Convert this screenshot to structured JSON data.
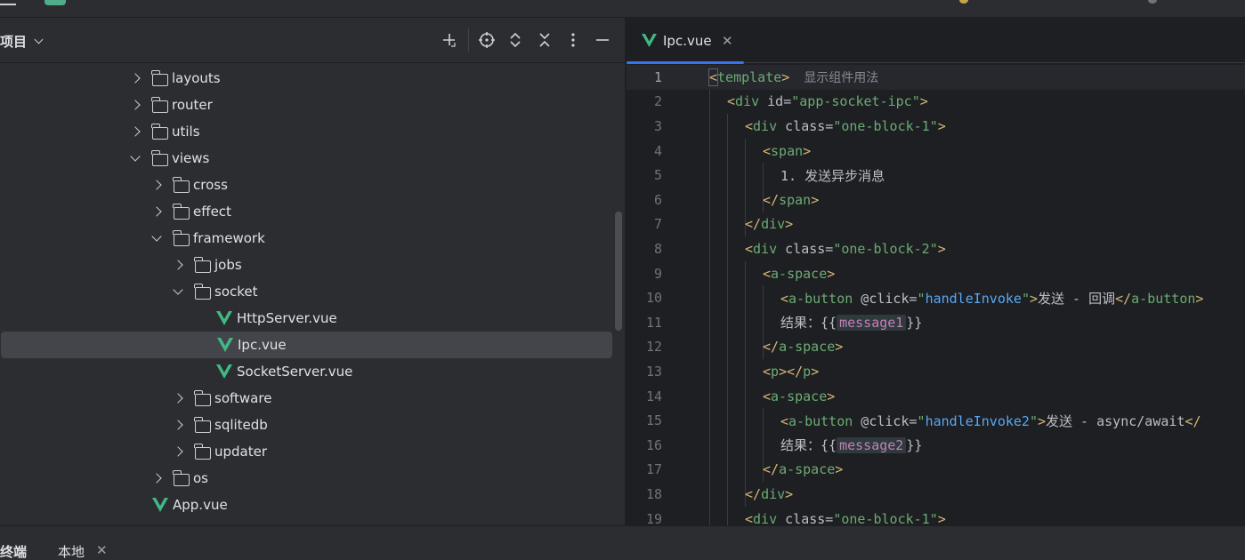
{
  "project_panel": {
    "title": "项目",
    "tree": [
      {
        "label": "layouts",
        "type": "folder",
        "expanded": false,
        "depth": 0
      },
      {
        "label": "router",
        "type": "folder",
        "expanded": false,
        "depth": 0
      },
      {
        "label": "utils",
        "type": "folder",
        "expanded": false,
        "depth": 0
      },
      {
        "label": "views",
        "type": "folder",
        "expanded": true,
        "depth": 0
      },
      {
        "label": "cross",
        "type": "folder",
        "expanded": false,
        "depth": 1
      },
      {
        "label": "effect",
        "type": "folder",
        "expanded": false,
        "depth": 1
      },
      {
        "label": "framework",
        "type": "folder",
        "expanded": true,
        "depth": 1
      },
      {
        "label": "jobs",
        "type": "folder",
        "expanded": false,
        "depth": 2
      },
      {
        "label": "socket",
        "type": "folder",
        "expanded": true,
        "depth": 2
      },
      {
        "label": "HttpServer.vue",
        "type": "vue",
        "depth": 3
      },
      {
        "label": "Ipc.vue",
        "type": "vue",
        "depth": 3,
        "selected": true
      },
      {
        "label": "SocketServer.vue",
        "type": "vue",
        "depth": 3
      },
      {
        "label": "software",
        "type": "folder",
        "expanded": false,
        "depth": 2
      },
      {
        "label": "sqlitedb",
        "type": "folder",
        "expanded": false,
        "depth": 2
      },
      {
        "label": "updater",
        "type": "folder",
        "expanded": false,
        "depth": 2
      },
      {
        "label": "os",
        "type": "folder",
        "expanded": false,
        "depth": 1
      },
      {
        "label": "App.vue",
        "type": "vue",
        "depth": 0
      }
    ]
  },
  "editor": {
    "tab_label": "Ipc.vue",
    "close_glyph": "✕",
    "inlay_hint": "显示组件用法",
    "lines": [
      {
        "n": "1",
        "indent": 0,
        "parts": [
          [
            "bracket-hl",
            "<"
          ],
          [
            "tn",
            "template"
          ],
          [
            "tg",
            ">"
          ]
        ],
        "hint": true
      },
      {
        "n": "2",
        "indent": 1,
        "parts": [
          [
            "tg",
            "<"
          ],
          [
            "tn",
            "div"
          ],
          [
            "an",
            " id="
          ],
          [
            "av",
            "\"app-socket-ipc\""
          ],
          [
            "tg",
            ">"
          ]
        ]
      },
      {
        "n": "3",
        "indent": 2,
        "parts": [
          [
            "tg",
            "<"
          ],
          [
            "tn",
            "div"
          ],
          [
            "an",
            " class="
          ],
          [
            "av",
            "\"one-block-1\""
          ],
          [
            "tg",
            ">"
          ]
        ]
      },
      {
        "n": "4",
        "indent": 3,
        "parts": [
          [
            "tg",
            "<"
          ],
          [
            "tn",
            "span"
          ],
          [
            "tg",
            ">"
          ]
        ]
      },
      {
        "n": "5",
        "indent": 4,
        "parts": [
          [
            "tx",
            "1. 发送异步消息"
          ]
        ]
      },
      {
        "n": "6",
        "indent": 3,
        "parts": [
          [
            "tg",
            "</"
          ],
          [
            "tn",
            "span"
          ],
          [
            "tg",
            ">"
          ]
        ]
      },
      {
        "n": "7",
        "indent": 2,
        "parts": [
          [
            "tg",
            "</"
          ],
          [
            "tn",
            "div"
          ],
          [
            "tg",
            ">"
          ]
        ]
      },
      {
        "n": "8",
        "indent": 2,
        "parts": [
          [
            "tg",
            "<"
          ],
          [
            "tn",
            "div"
          ],
          [
            "an",
            " class="
          ],
          [
            "av",
            "\"one-block-2\""
          ],
          [
            "tg",
            ">"
          ]
        ]
      },
      {
        "n": "9",
        "indent": 3,
        "parts": [
          [
            "tg",
            "<"
          ],
          [
            "tn",
            "a-space"
          ],
          [
            "tg",
            ">"
          ]
        ]
      },
      {
        "n": "10",
        "indent": 4,
        "parts": [
          [
            "tg",
            "<"
          ],
          [
            "tn",
            "a-button"
          ],
          [
            "an",
            " @click="
          ],
          [
            "av",
            "\""
          ],
          [
            "ev",
            "handleInvoke"
          ],
          [
            "av",
            "\""
          ],
          [
            "tg",
            ">"
          ],
          [
            "tx",
            "发送 - 回调"
          ],
          [
            "tg",
            "</"
          ],
          [
            "tn",
            "a-button"
          ],
          [
            "tg",
            ">"
          ]
        ]
      },
      {
        "n": "11",
        "indent": 4,
        "parts": [
          [
            "tx",
            "结果："
          ],
          [
            "br",
            "{{"
          ],
          [
            "hl",
            "message1"
          ],
          [
            "br",
            "}}"
          ]
        ]
      },
      {
        "n": "12",
        "indent": 3,
        "parts": [
          [
            "tg",
            "</"
          ],
          [
            "tn",
            "a-space"
          ],
          [
            "tg",
            ">"
          ]
        ]
      },
      {
        "n": "13",
        "indent": 3,
        "parts": [
          [
            "tg",
            "<"
          ],
          [
            "tn",
            "p"
          ],
          [
            "tg",
            "></"
          ],
          [
            "tn",
            "p"
          ],
          [
            "tg",
            ">"
          ]
        ]
      },
      {
        "n": "14",
        "indent": 3,
        "parts": [
          [
            "tg",
            "<"
          ],
          [
            "tn",
            "a-space"
          ],
          [
            "tg",
            ">"
          ]
        ]
      },
      {
        "n": "15",
        "indent": 4,
        "parts": [
          [
            "tg",
            "<"
          ],
          [
            "tn",
            "a-button"
          ],
          [
            "an",
            " @click="
          ],
          [
            "av",
            "\""
          ],
          [
            "ev",
            "handleInvoke2"
          ],
          [
            "av",
            "\""
          ],
          [
            "tg",
            ">"
          ],
          [
            "tx",
            "发送 - async/await"
          ],
          [
            "tg",
            "</"
          ]
        ]
      },
      {
        "n": "16",
        "indent": 4,
        "parts": [
          [
            "tx",
            "结果："
          ],
          [
            "br",
            "{{"
          ],
          [
            "hl",
            "message2"
          ],
          [
            "br",
            "}}"
          ]
        ]
      },
      {
        "n": "17",
        "indent": 3,
        "parts": [
          [
            "tg",
            "</"
          ],
          [
            "tn",
            "a-space"
          ],
          [
            "tg",
            ">"
          ]
        ]
      },
      {
        "n": "18",
        "indent": 2,
        "parts": [
          [
            "tg",
            "</"
          ],
          [
            "tn",
            "div"
          ],
          [
            "tg",
            ">"
          ]
        ]
      },
      {
        "n": "19",
        "indent": 2,
        "parts": [
          [
            "tg",
            "<"
          ],
          [
            "tn",
            "div"
          ],
          [
            "an",
            " class="
          ],
          [
            "av",
            "\"one-block-1\""
          ],
          [
            "tg",
            ">"
          ]
        ]
      }
    ]
  },
  "bottom": {
    "terminal_label": "终端",
    "local_tab_label": "本地",
    "close_glyph": "✕"
  },
  "icons": {
    "new": "plus-icon",
    "locate": "crosshair-icon",
    "expand": "expand-all-icon",
    "collapse": "collapse-all-icon",
    "more": "more-vertical-icon",
    "hide": "minimize-icon",
    "vue": "vue-file-icon",
    "folder": "folder-icon"
  },
  "colors": {
    "accent": "#3574f0",
    "vue_green": "#41b883"
  }
}
